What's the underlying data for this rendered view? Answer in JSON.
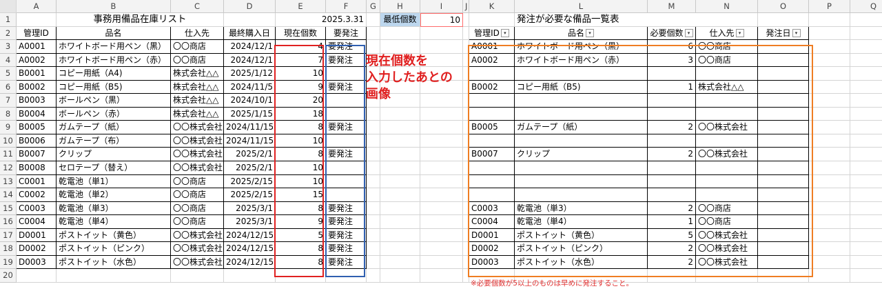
{
  "columns": [
    "A",
    "B",
    "C",
    "D",
    "E",
    "F",
    "G",
    "H",
    "I",
    "J",
    "K",
    "L",
    "M",
    "N",
    "O",
    "P",
    "Q"
  ],
  "rows": [
    "1",
    "2",
    "3",
    "4",
    "5",
    "6",
    "7",
    "8",
    "9",
    "10",
    "11",
    "12",
    "13",
    "14",
    "15",
    "16",
    "17",
    "18",
    "19",
    "20"
  ],
  "inventory": {
    "title": "事務用備品在庫リスト",
    "date": "2025.3.31",
    "headers": [
      "管理ID",
      "品名",
      "仕入先",
      "最終購入日",
      "現在個数",
      "要発注"
    ],
    "rows": [
      [
        "A0001",
        "ホワイトボード用ペン（黒）",
        "〇〇商店",
        "2024/12/1",
        "4",
        "要発注"
      ],
      [
        "A0002",
        "ホワイトボード用ペン（赤）",
        "〇〇商店",
        "2024/12/1",
        "7",
        "要発注"
      ],
      [
        "B0001",
        "コピー用紙（A4)",
        "株式会社△△",
        "2025/1/12",
        "10",
        ""
      ],
      [
        "B0002",
        "コピー用紙（B5)",
        "株式会社△△",
        "2024/11/5",
        "9",
        "要発注"
      ],
      [
        "B0003",
        "ボールペン（黒）",
        "株式会社△△",
        "2024/10/1",
        "20",
        ""
      ],
      [
        "B0004",
        "ボールペン（赤）",
        "株式会社△△",
        "2025/1/15",
        "18",
        ""
      ],
      [
        "B0005",
        "ガムテープ（紙）",
        "〇〇株式会社",
        "2024/11/15",
        "8",
        "要発注"
      ],
      [
        "B0006",
        "ガムテープ（布）",
        "〇〇株式会社",
        "2024/11/15",
        "10",
        ""
      ],
      [
        "B0007",
        "クリップ",
        "〇〇株式会社",
        "2025/2/1",
        "8",
        "要発注"
      ],
      [
        "B0008",
        "セロテープ（替え）",
        "〇〇株式会社",
        "2025/2/1",
        "10",
        ""
      ],
      [
        "C0001",
        "乾電池（単1）",
        "〇〇商店",
        "2025/2/15",
        "10",
        ""
      ],
      [
        "C0002",
        "乾電池（単2）",
        "〇〇商店",
        "2025/2/15",
        "15",
        ""
      ],
      [
        "C0003",
        "乾電池（単3）",
        "〇〇商店",
        "2025/3/1",
        "8",
        "要発注"
      ],
      [
        "C0004",
        "乾電池（単4）",
        "〇〇商店",
        "2025/3/1",
        "9",
        "要発注"
      ],
      [
        "D0001",
        "ポストイット（黄色）",
        "〇〇株式会社",
        "2024/12/15",
        "5",
        "要発注"
      ],
      [
        "D0002",
        "ポストイット（ピンク）",
        "〇〇株式会社",
        "2024/12/15",
        "8",
        "要発注"
      ],
      [
        "D0003",
        "ポストイット（水色）",
        "〇〇株式会社",
        "2024/12/15",
        "8",
        "要発注"
      ]
    ]
  },
  "min_stock": {
    "label": "最低個数",
    "value": "10"
  },
  "order_list": {
    "title": "発注が必要な備品一覧表",
    "headers": [
      "管理ID",
      "品名",
      "必要個数",
      "仕入先",
      "発注日"
    ],
    "filter_glyph": "▾",
    "rows": [
      [
        "A0001",
        "ホワイトボード用ペン（黒）",
        "6",
        "〇〇商店",
        ""
      ],
      [
        "A0002",
        "ホワイトボード用ペン（赤）",
        "3",
        "〇〇商店",
        ""
      ],
      [
        "",
        "",
        "",
        "",
        ""
      ],
      [
        "B0002",
        "コピー用紙（B5)",
        "1",
        "株式会社△△",
        ""
      ],
      [
        "",
        "",
        "",
        "",
        ""
      ],
      [
        "",
        "",
        "",
        "",
        ""
      ],
      [
        "B0005",
        "ガムテープ（紙）",
        "2",
        "〇〇株式会社",
        ""
      ],
      [
        "",
        "",
        "",
        "",
        ""
      ],
      [
        "B0007",
        "クリップ",
        "2",
        "〇〇株式会社",
        ""
      ],
      [
        "",
        "",
        "",
        "",
        ""
      ],
      [
        "",
        "",
        "",
        "",
        ""
      ],
      [
        "",
        "",
        "",
        "",
        ""
      ],
      [
        "C0003",
        "乾電池（単3）",
        "2",
        "〇〇商店",
        ""
      ],
      [
        "C0004",
        "乾電池（単4）",
        "1",
        "〇〇商店",
        ""
      ],
      [
        "D0001",
        "ポストイット（黄色）",
        "5",
        "〇〇株式会社",
        ""
      ],
      [
        "D0002",
        "ポストイット（ピンク）",
        "2",
        "〇〇株式会社",
        ""
      ],
      [
        "D0003",
        "ポストイット（水色）",
        "2",
        "〇〇株式会社",
        ""
      ]
    ],
    "note": "※必要個数が5以上のものは早めに発注すること。"
  },
  "callout": "現在個数を\n入力したあとの\n画像",
  "colors": {
    "red_box": "#e02020",
    "blue_box": "#2f5fb0",
    "orange_box": "#ef7d22",
    "header_blue": "#bdd7ee"
  }
}
